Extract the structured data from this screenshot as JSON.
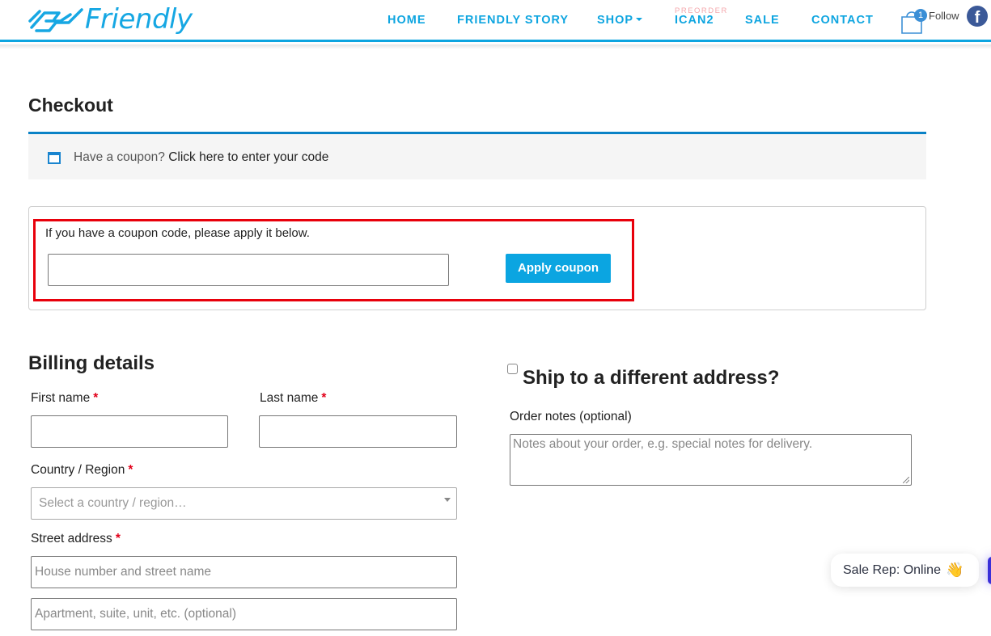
{
  "header": {
    "logo_text": "Friendly",
    "nav": [
      {
        "label": "HOME"
      },
      {
        "label": "FRIENDLY STORY"
      },
      {
        "label": "SHOP"
      },
      {
        "label": "ICAN2",
        "superscript": "PREORDER"
      },
      {
        "label": "SALE"
      },
      {
        "label": "CONTACT"
      }
    ],
    "cart_count": "1",
    "follow_label": "Follow",
    "facebook_glyph": "f"
  },
  "page": {
    "title": "Checkout"
  },
  "coupon_notice": {
    "prompt": "Have a coupon?",
    "link": "Click here to enter your code"
  },
  "coupon_form": {
    "label": "If you have a coupon code, please apply it below.",
    "input_value": "",
    "apply_label": "Apply coupon"
  },
  "billing": {
    "title": "Billing details",
    "first_name_label": "First name",
    "last_name_label": "Last name",
    "country_label": "Country / Region",
    "country_placeholder": "Select a country / region…",
    "street_label": "Street address",
    "street1_placeholder": "House number and street name",
    "street2_placeholder": "Apartment, suite, unit, etc. (optional)",
    "required_mark": "*"
  },
  "shipping": {
    "ship_different_label": "Ship to a different address?",
    "ship_different_checked": false,
    "notes_label": "Order notes (optional)",
    "notes_placeholder": "Notes about your order, e.g. special notes for delivery."
  },
  "chat": {
    "status": "Sale Rep: Online",
    "emoji": "👋"
  },
  "colors": {
    "brand": "#0ea5e0",
    "highlight": "#e8000b",
    "required": "#e2001a"
  }
}
